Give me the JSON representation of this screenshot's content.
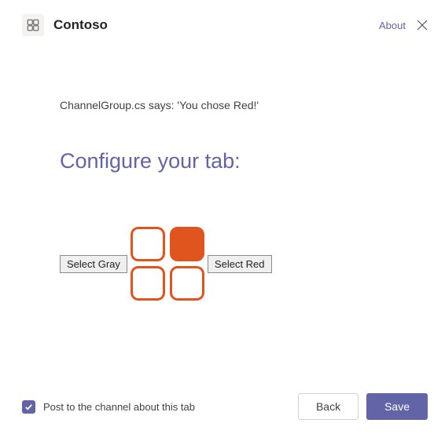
{
  "header": {
    "app_name": "Contoso",
    "about_label": "About"
  },
  "content": {
    "status_message": "ChannelGroup.cs says: 'You chose Red!'",
    "heading": "Configure your tab:",
    "select_gray_label": "Select Gray",
    "select_red_label": "Select Red"
  },
  "footer": {
    "post_label": "Post to the channel about this tab",
    "post_checked": true,
    "back_label": "Back",
    "save_label": "Save"
  },
  "colors": {
    "accent": "#6264a7",
    "tile_orange": "#e0551d"
  }
}
